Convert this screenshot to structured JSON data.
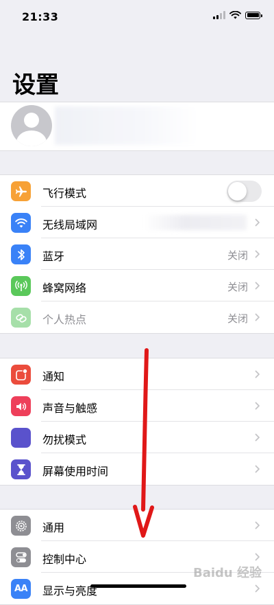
{
  "status": {
    "time": "21:33"
  },
  "title": "设置",
  "groups": [
    {
      "rows": [
        {
          "label": "飞行模式",
          "icon": "airplane-icon",
          "color": "#f7a136",
          "toggle": false
        },
        {
          "label": "无线局域网",
          "icon": "wifi-icon",
          "color": "#3a82f7"
        },
        {
          "label": "蓝牙",
          "icon": "bluetooth-icon",
          "color": "#3a82f7",
          "value": "关闭"
        },
        {
          "label": "蜂窝网络",
          "icon": "antenna-icon",
          "color": "#5ac85a",
          "value": "关闭"
        },
        {
          "label": "个人热点",
          "icon": "hotspot-icon",
          "color": "#a6dfa9",
          "value": "关闭",
          "dimmed": true
        }
      ]
    },
    {
      "rows": [
        {
          "label": "通知",
          "icon": "notification-icon",
          "color": "#eb4c3c"
        },
        {
          "label": "声音与触感",
          "icon": "speaker-icon",
          "color": "#ee3f5a"
        },
        {
          "label": "勿扰模式",
          "icon": "moon-icon",
          "color": "#5a52cc"
        },
        {
          "label": "屏幕使用时间",
          "icon": "hourglass-icon",
          "color": "#5a52cc"
        }
      ]
    },
    {
      "rows": [
        {
          "label": "通用",
          "icon": "gear-icon",
          "color": "#8e8e93"
        },
        {
          "label": "控制中心",
          "icon": "toggles-icon",
          "color": "#8e8e93"
        },
        {
          "label": "显示与亮度",
          "icon": "display-icon",
          "color": "#3a82f7",
          "icon_text": "AA"
        }
      ]
    }
  ],
  "watermark": "Baidu 经验"
}
